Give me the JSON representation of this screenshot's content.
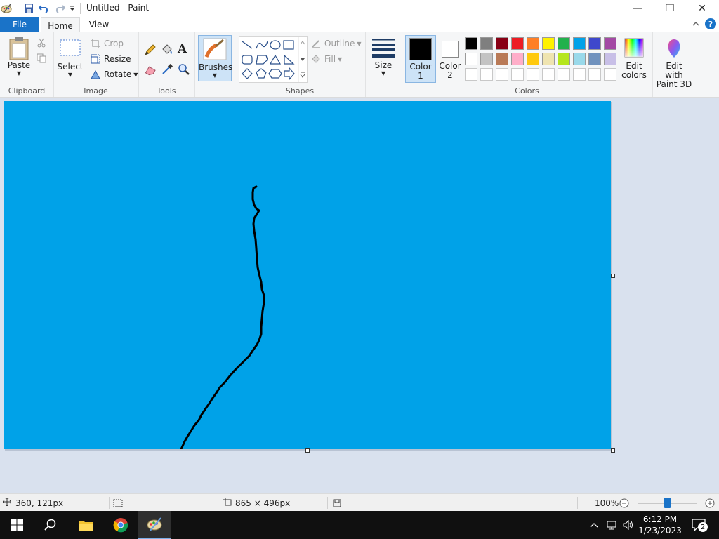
{
  "window": {
    "title": "Untitled - Paint",
    "minimize_glyph": "—",
    "restore_glyph": "❐",
    "close_glyph": "✕"
  },
  "quick_access": {
    "icons": [
      "paint-app-icon",
      "save-icon",
      "undo-icon",
      "redo-icon",
      "customize-dropdown-icon"
    ]
  },
  "tabs": {
    "file": "File",
    "home": "Home",
    "view": "View"
  },
  "ribbon": {
    "clipboard": {
      "label": "Clipboard",
      "paste": "Paste"
    },
    "image": {
      "label": "Image",
      "select": "Select",
      "crop": "Crop",
      "resize": "Resize",
      "rotate": "Rotate"
    },
    "tools": {
      "label": "Tools"
    },
    "brushes": {
      "label": "Brushes"
    },
    "shapes": {
      "label": "Shapes",
      "outline": "Outline",
      "fill": "Fill"
    },
    "size": {
      "label": "Size"
    },
    "color1": {
      "line1": "Color",
      "line2": "1",
      "value": "#000000"
    },
    "color2": {
      "line1": "Color",
      "line2": "2",
      "value": "#ffffff"
    },
    "colors": {
      "label": "Colors",
      "palette_row1": [
        "#000000",
        "#7f7f7f",
        "#880015",
        "#ed1c24",
        "#ff7f27",
        "#fff200",
        "#22b14c",
        "#00a2e8",
        "#3f48cc",
        "#a349a4"
      ],
      "palette_row2": [
        "#ffffff",
        "#c3c3c3",
        "#b97a57",
        "#ffaec9",
        "#ffc90e",
        "#efe4b0",
        "#b5e61d",
        "#99d9ea",
        "#7092be",
        "#c8bfe7"
      ],
      "palette_row3": [
        "#ffffff",
        "#ffffff",
        "#ffffff",
        "#ffffff",
        "#ffffff",
        "#ffffff",
        "#ffffff",
        "#ffffff",
        "#ffffff",
        "#ffffff"
      ]
    },
    "edit_colors": {
      "line1": "Edit",
      "line2": "colors"
    },
    "edit_with_paint3d": {
      "line1": "Edit with",
      "line2": "Paint 3D"
    }
  },
  "canvas": {
    "fill": "#00a2e8",
    "stroke_color": "#000000"
  },
  "status": {
    "cursor_position": "360, 121px",
    "canvas_size": "865 × 496px",
    "zoom": "100%",
    "zoom_level_fraction": 0.5
  },
  "taskbar": {
    "time": "6:12 PM",
    "date": "1/23/2023",
    "notification_count": "2",
    "apps": [
      "start-icon",
      "search-icon",
      "file-explorer-icon",
      "chrome-icon",
      "paint-taskbar-icon"
    ]
  },
  "accent_color": "#1a73c8"
}
